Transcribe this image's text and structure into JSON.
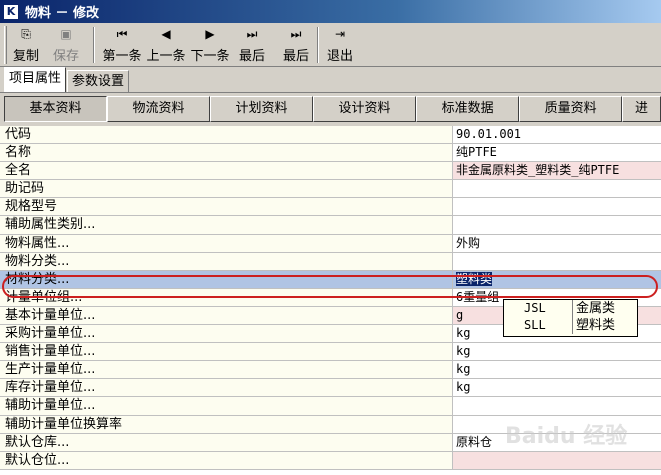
{
  "window": {
    "title": "物料 － 修改",
    "icon_text": "K"
  },
  "toolbar": {
    "buttons": [
      {
        "label": "复制",
        "icon": "copy-icon",
        "enabled": true
      },
      {
        "label": "保存",
        "icon": "save-icon",
        "enabled": false
      },
      {
        "label": "第一条",
        "icon": "first-record-icon",
        "enabled": true
      },
      {
        "label": "上一条",
        "icon": "previous-record-icon",
        "enabled": true
      },
      {
        "label": "下一条",
        "icon": "next-record-icon",
        "enabled": true
      },
      {
        "label": "最后",
        "icon": "last-record-icon",
        "enabled": true
      },
      {
        "label": "最后",
        "icon": "last-record-icon",
        "enabled": true
      },
      {
        "label": "退出",
        "icon": "exit-icon",
        "enabled": true
      }
    ]
  },
  "tabs_outer": [
    "项目属性",
    "参数设置"
  ],
  "tabs_inner": [
    "基本资料",
    "物流资料",
    "计划资料",
    "设计资料",
    "标准数据",
    "质量资料",
    "进"
  ],
  "rows": [
    {
      "label": "代码",
      "value": "90.01.001"
    },
    {
      "label": "名称",
      "value": "纯PTFE"
    },
    {
      "label": "全名",
      "value": "非金属原料类_塑料类_纯PTFE"
    },
    {
      "label": "助记码",
      "value": ""
    },
    {
      "label": "规格型号",
      "value": ""
    },
    {
      "label": "辅助属性类别...",
      "value": ""
    },
    {
      "label": "物料属性...",
      "value": "外购"
    },
    {
      "label": "物料分类...",
      "value": ""
    },
    {
      "label": "材料分类...",
      "value": "塑料类"
    },
    {
      "label": "计量单位组...",
      "value": "6重量组"
    },
    {
      "label": "基本计量单位...",
      "value": "g"
    },
    {
      "label": "采购计量单位...",
      "value": "kg"
    },
    {
      "label": "销售计量单位...",
      "value": "kg"
    },
    {
      "label": "生产计量单位...",
      "value": "kg"
    },
    {
      "label": "库存计量单位...",
      "value": "kg"
    },
    {
      "label": "辅助计量单位...",
      "value": ""
    },
    {
      "label": "辅助计量单位换算率",
      "value": ""
    },
    {
      "label": "默认仓库...",
      "value": "原料仓"
    },
    {
      "label": "默认仓位...",
      "value": ""
    }
  ],
  "dropdown": {
    "items": [
      {
        "code": "JSL",
        "name": "金属类"
      },
      {
        "code": "SLL",
        "name": "塑料类"
      }
    ]
  },
  "watermark": "Baidu 经验"
}
